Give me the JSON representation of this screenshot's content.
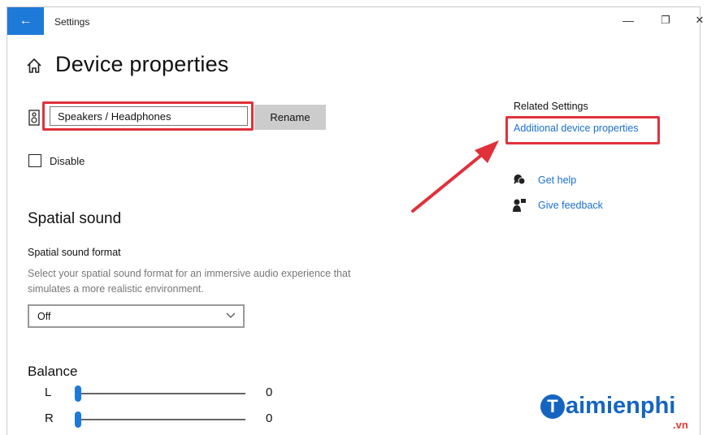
{
  "window": {
    "title": "Settings",
    "back_icon": "←",
    "minimize_icon": "—",
    "maximize_icon": "❐",
    "close_icon": "✕"
  },
  "page": {
    "title": "Device properties"
  },
  "device": {
    "name_value": "Speakers / Headphones",
    "rename_label": "Rename",
    "disable_label": "Disable",
    "disabled": false
  },
  "spatial": {
    "section_title": "Spatial sound",
    "format_label": "Spatial sound format",
    "description": "Select your spatial sound format for an immersive audio experience that simulates a more realistic environment.",
    "selected": "Off"
  },
  "balance": {
    "title": "Balance",
    "channels": [
      {
        "label": "L",
        "value": "0",
        "level": 0
      },
      {
        "label": "R",
        "value": "0",
        "level": 0
      }
    ]
  },
  "related": {
    "title": "Related Settings",
    "link": "Additional device properties",
    "help_label": "Get help",
    "feedback_label": "Give feedback"
  },
  "watermark": {
    "brand": "aimienphi",
    "brand_initial": "T",
    "tld": ".vn"
  },
  "colors": {
    "accent": "#1e7ad8",
    "link": "#1a6fd0",
    "highlight": "#e0313b",
    "brand": "#1565c0"
  }
}
